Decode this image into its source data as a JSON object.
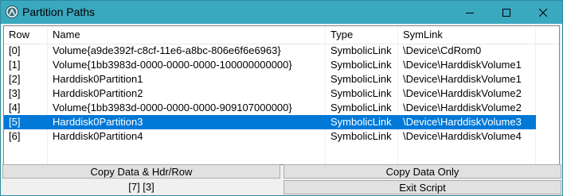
{
  "window": {
    "title": "Partition Paths",
    "icon": "autoit-icon",
    "accent": "#3aa8bf"
  },
  "listview": {
    "columns": [
      "Row",
      "Name",
      "Type",
      "SymLink"
    ],
    "selected_index": 5,
    "selection_color": "#0078d7",
    "rows": [
      {
        "row": "[0]",
        "name": "Volume{a9de392f-c8cf-11e6-a8bc-806e6f6e6963}",
        "type": "SymbolicLink",
        "symlink": "\\Device\\CdRom0"
      },
      {
        "row": "[1]",
        "name": "Volume{1bb3983d-0000-0000-0000-100000000000}",
        "type": "SymbolicLink",
        "symlink": "\\Device\\HarddiskVolume1"
      },
      {
        "row": "[2]",
        "name": "Harddisk0Partition1",
        "type": "SymbolicLink",
        "symlink": "\\Device\\HarddiskVolume1"
      },
      {
        "row": "[3]",
        "name": "Harddisk0Partition2",
        "type": "SymbolicLink",
        "symlink": "\\Device\\HarddiskVolume2"
      },
      {
        "row": "[4]",
        "name": "Volume{1bb3983d-0000-0000-0000-909107000000}",
        "type": "SymbolicLink",
        "symlink": "\\Device\\HarddiskVolume2"
      },
      {
        "row": "[5]",
        "name": "Harddisk0Partition3",
        "type": "SymbolicLink",
        "symlink": "\\Device\\HarddiskVolume3"
      },
      {
        "row": "[6]",
        "name": "Harddisk0Partition4",
        "type": "SymbolicLink",
        "symlink": "\\Device\\HarddiskVolume4"
      }
    ]
  },
  "buttons": {
    "copy_data_hdr_row": "Copy Data & Hdr/Row",
    "copy_data_only": "Copy Data Only",
    "exit_script": "Exit Script"
  },
  "status": {
    "count": "[7] [3]"
  }
}
